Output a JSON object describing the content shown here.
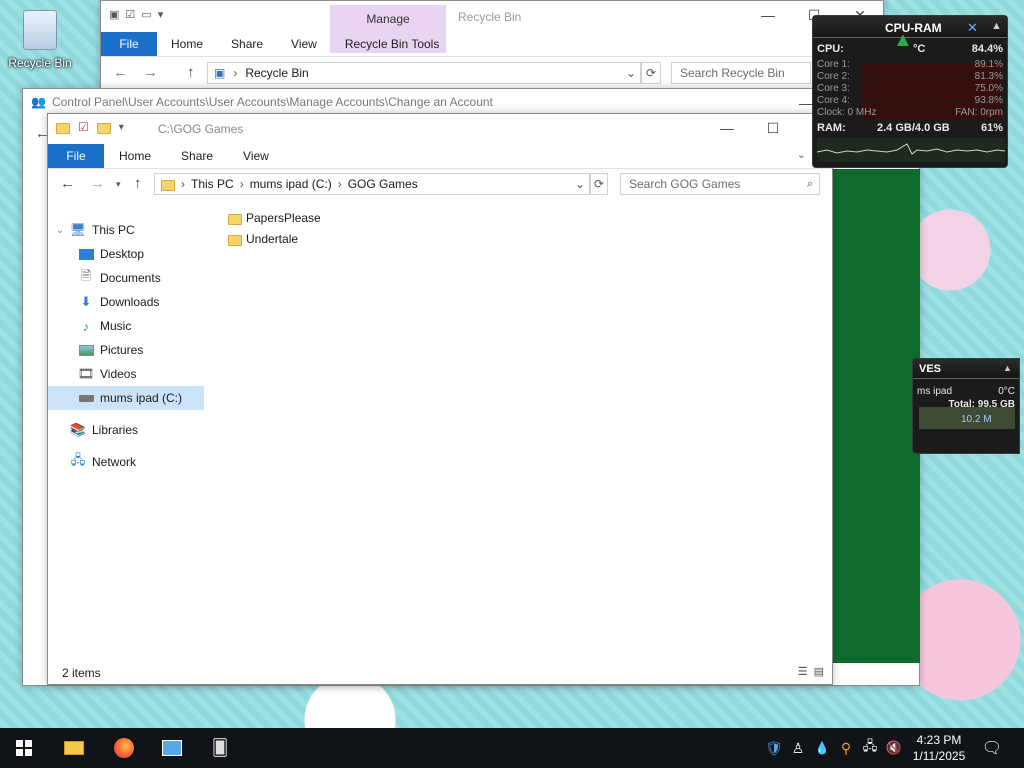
{
  "desktop": {
    "recycle_label": "Recycle Bin"
  },
  "recycle_window": {
    "title": "Recycle Bin",
    "context_tab": "Manage",
    "tabs": [
      "File",
      "Home",
      "Share",
      "View",
      "Recycle Bin Tools"
    ],
    "address": "Recycle Bin",
    "search_placeholder": "Search Recycle Bin"
  },
  "control_panel_window": {
    "title": "Control Panel\\User Accounts\\User Accounts\\Manage Accounts\\Change an Account"
  },
  "explorer": {
    "title": "C:\\GOG Games",
    "tabs": [
      "File",
      "Home",
      "Share",
      "View"
    ],
    "breadcrumb": [
      "This PC",
      "mums ipad (C:)",
      "GOG Games"
    ],
    "search_placeholder": "Search GOG Games",
    "nav": [
      "This PC",
      "Desktop",
      "Documents",
      "Downloads",
      "Music",
      "Pictures",
      "Videos",
      "mums ipad (C:)",
      "Libraries",
      "Network"
    ],
    "files": [
      "PapersPlease",
      "Undertale"
    ],
    "status": "2 items"
  },
  "cpu_gadget": {
    "title": "CPU-RAM",
    "cpu_label": "CPU:",
    "cpu_temp": "°C",
    "cpu_value": "84.4%",
    "cores": [
      {
        "label": "Core 1:",
        "value": "89.1%"
      },
      {
        "label": "Core 2:",
        "value": "81.3%"
      },
      {
        "label": "Core 3:",
        "value": "75.0%"
      },
      {
        "label": "Core 4:",
        "value": "93.8%"
      }
    ],
    "clock": "Clock: 0 MHz",
    "fan": "FAN: 0rpm",
    "ram_label": "RAM:",
    "ram_value": "2.4 GB/4.0 GB",
    "ram_pct": "61%"
  },
  "drives_gadget": {
    "title": "VES",
    "drive_name": "ms ipad",
    "drive_temp": "0°C",
    "total": "Total: 99.5 GB",
    "free": "10.2 M"
  },
  "taskbar": {
    "time": "4:23 PM",
    "date": "1/11/2025"
  }
}
